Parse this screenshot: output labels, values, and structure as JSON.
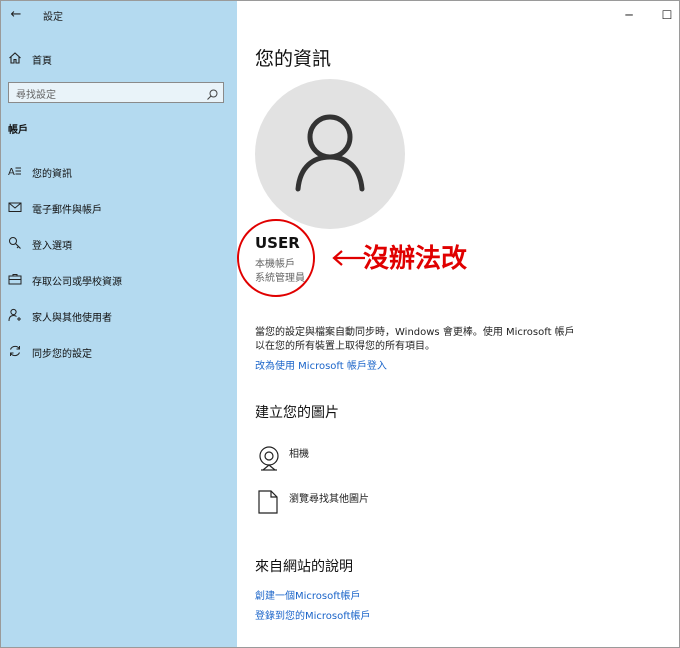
{
  "app": {
    "title": "設定",
    "back_glyph": "←"
  },
  "window": {
    "minimize_glyph": "─",
    "maximize_glyph": "☐"
  },
  "sidebar": {
    "home_label": "首頁",
    "search_placeholder": "尋找設定",
    "section_title": "帳戶",
    "items": [
      {
        "label": "您的資訊",
        "icon": "person-card-icon"
      },
      {
        "label": "電子郵件與帳戶",
        "icon": "mail-icon"
      },
      {
        "label": "登入選項",
        "icon": "key-icon"
      },
      {
        "label": "存取公司或學校資源",
        "icon": "briefcase-icon"
      },
      {
        "label": "家人與其他使用者",
        "icon": "add-person-icon"
      },
      {
        "label": "同步您的設定",
        "icon": "sync-icon"
      }
    ]
  },
  "main": {
    "title": "您的資訊",
    "username": "USER",
    "account_type": "本機帳戶",
    "account_role": "系統管理員",
    "annotation": "沒辦法改",
    "sync_text_line1": "當您的設定與檔案自動同步時，Windows 會更棒。使用 Microsoft 帳戶",
    "sync_text_line2": "以在您的所有裝置上取得您的所有項目。",
    "ms_signin_link": "改為使用 Microsoft 帳戶登入",
    "create_picture_title": "建立您的圖片",
    "picture_options": [
      {
        "label": "相機",
        "icon": "camera-icon"
      },
      {
        "label": "瀏覽尋找其他圖片",
        "icon": "document-icon"
      }
    ],
    "help_title": "來自網站的說明",
    "help_links": [
      "創建一個Microsoft帳戶",
      "登錄到您的Microsoft帳戶"
    ]
  },
  "colors": {
    "sidebar_bg": "#b4daf0",
    "link": "#1a64c9",
    "annotation": "#e00000"
  }
}
